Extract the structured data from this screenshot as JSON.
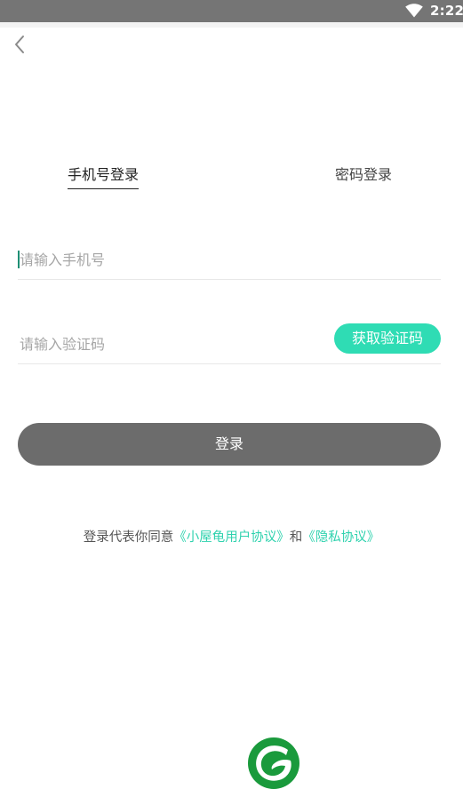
{
  "status_bar": {
    "time": "2:22",
    "wifi_icon": "wifi-icon"
  },
  "nav": {
    "back_icon": "chevron-left-icon"
  },
  "tabs": [
    {
      "label": "手机号登录",
      "active": true
    },
    {
      "label": "密码登录",
      "active": false
    }
  ],
  "form": {
    "phone_placeholder": "请输入手机号",
    "phone_value": "",
    "code_placeholder": "请输入验证码",
    "code_value": "",
    "get_code_label": "获取验证码",
    "login_label": "登录"
  },
  "agreement": {
    "prefix": "登录代表你同意",
    "user_agreement": "《小屋龟用户协议》",
    "conjunction": "和",
    "privacy_policy": "《隐私协议》"
  },
  "logo": {
    "icon": "leaf-logo-icon"
  },
  "colors": {
    "accent": "#2fdcb4",
    "link": "#2fd2ae",
    "button_disabled": "#6c6c6c",
    "status_bar": "#757575",
    "logo_green": "#1a9a3c"
  }
}
